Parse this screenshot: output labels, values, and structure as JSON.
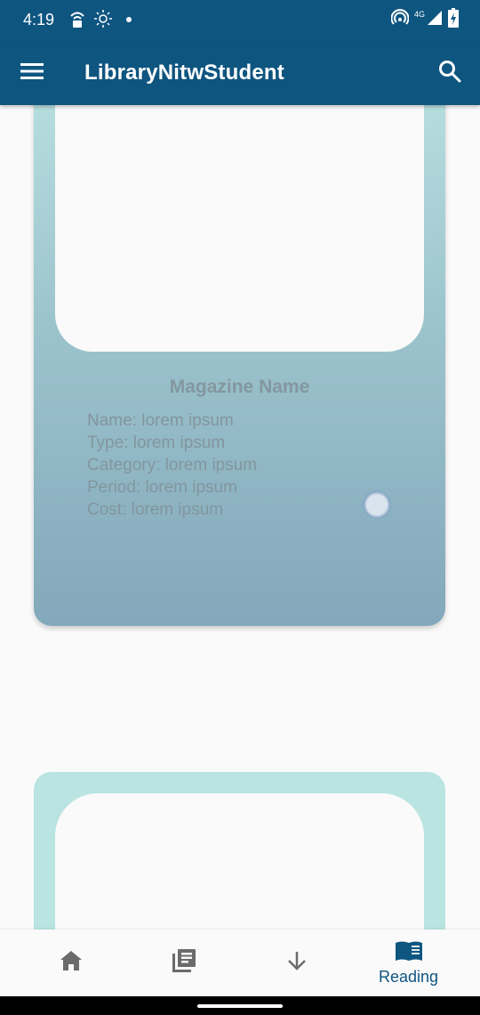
{
  "status_bar": {
    "time": "4:19",
    "network_label": "4G",
    "icons": [
      "vpn-lock-icon",
      "brightness-icon",
      "notification-dot",
      "hotspot-icon",
      "signal-icon",
      "battery-charging-icon"
    ]
  },
  "app_bar": {
    "title": "LibraryNitwStudent",
    "menu_icon": "menu-icon",
    "search_icon": "search-icon",
    "color": "#0e5580"
  },
  "cards": [
    {
      "title": "Magazine Name",
      "details": [
        "Name: lorem ipsum",
        "Type: lorem ipsum",
        "Category: lorem ipsum",
        "Period: lorem ipsum",
        "Cost: lorem ipsum"
      ],
      "selected": false
    }
  ],
  "bottom_nav": {
    "items": [
      {
        "icon": "home-icon",
        "label": ""
      },
      {
        "icon": "library-books-icon",
        "label": ""
      },
      {
        "icon": "arrow-down-icon",
        "label": ""
      },
      {
        "icon": "book-open-icon",
        "label": "Reading",
        "active": true
      }
    ],
    "active_color": "#0e5580",
    "inactive_color": "#6b6b6b"
  }
}
